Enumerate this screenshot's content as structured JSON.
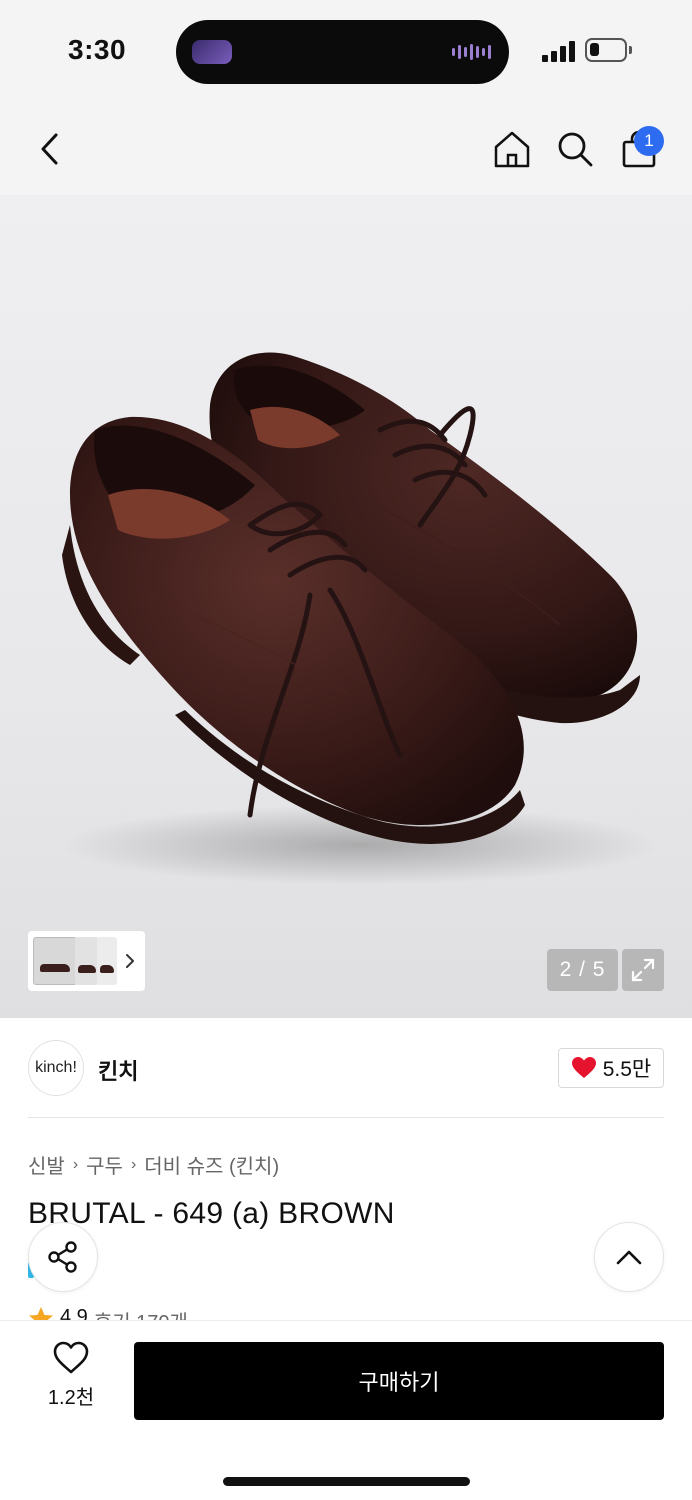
{
  "status_bar": {
    "time": "3:30"
  },
  "header": {
    "cart_count": "1",
    "icons": [
      "back-chevron-icon",
      "home-icon",
      "search-icon",
      "shopping-bag-icon"
    ]
  },
  "gallery": {
    "current": "2 / 5",
    "total_images": 5,
    "current_index": 2
  },
  "brand": {
    "logo_text": "kinch!",
    "name": "킨치",
    "likes": "5.5만"
  },
  "breadcrumb": [
    "신발",
    "구두",
    "더비 슈즈 (킨치)"
  ],
  "product": {
    "title": "BRUTAL - 649 (a) BROWN"
  },
  "rating": {
    "score": "4.9",
    "reviews": "후기 170개"
  },
  "bottom_bar": {
    "wish_count": "1.2천",
    "buy_label": "구매하기"
  },
  "colors": {
    "accent_badge": "#2d6cf0",
    "heart": "#e5132d",
    "buy_button": "#000000",
    "star": "#f5a623"
  }
}
